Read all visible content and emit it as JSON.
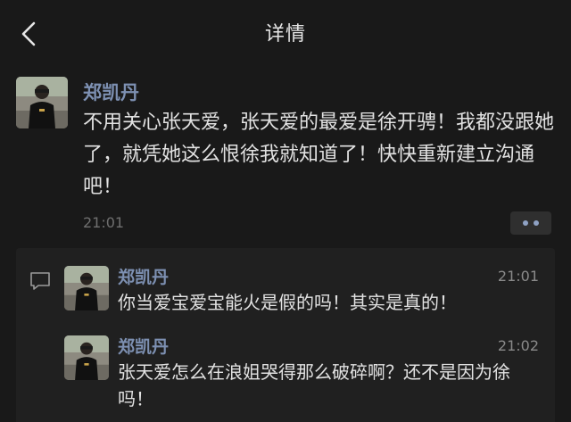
{
  "header": {
    "title": "详情",
    "back_icon": "chevron-left-icon"
  },
  "post": {
    "author": "郑凯丹",
    "content": "不用关心张天爱，张天爱的最爱是徐开骋！我都没跟她了，就凭她这么恨徐我就知道了！快快重新建立沟通吧！",
    "time": "21:01",
    "more_icon": "more-dots-icon"
  },
  "comments_icon": "comment-bubble-icon",
  "comments": [
    {
      "author": "郑凯丹",
      "time": "21:01",
      "text": "你当爱宝爱宝能火是假的吗！其实是真的！"
    },
    {
      "author": "郑凯丹",
      "time": "21:02",
      "text": "张天爱怎么在浪姐哭得那么破碎啊？还不是因为徐吗！"
    }
  ],
  "colors": {
    "background": "#191919",
    "name_link": "#7d90b2",
    "panel": "#202020"
  }
}
